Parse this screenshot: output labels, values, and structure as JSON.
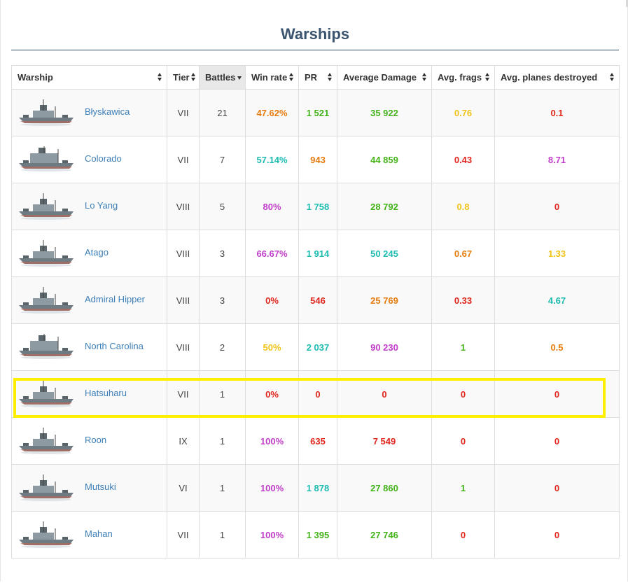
{
  "title": "Warships",
  "columns": [
    "Warship",
    "Tier",
    "Battles",
    "Win rate",
    "PR",
    "Average Damage",
    "Avg. frags",
    "Avg. planes destroyed"
  ],
  "sorted_column": "Battles",
  "colors": {
    "title": "#3b5470",
    "link": "#3d7fb8",
    "red": "#e0261d",
    "orange": "#e77c0e",
    "yellow": "#f0c419",
    "green": "#44b31a",
    "teal": "#1dbcb0",
    "purple": "#c13ec9",
    "highlight_box": "#ffee00"
  },
  "rows": [
    {
      "ship": "Błyskawica",
      "tier": "VII",
      "battles": "21",
      "winrate": "47.62%",
      "winrate_color": "#e77c0e",
      "pr": "1 521",
      "pr_color": "#44b31a",
      "dmg": "35 922",
      "dmg_color": "#44b31a",
      "frags": "0.76",
      "frags_color": "#f0c419",
      "planes": "0.1",
      "planes_color": "#e0261d",
      "icon": "destroyer-icon"
    },
    {
      "ship": "Colorado",
      "tier": "VII",
      "battles": "7",
      "winrate": "57.14%",
      "winrate_color": "#1dbcb0",
      "pr": "943",
      "pr_color": "#e77c0e",
      "dmg": "44 859",
      "dmg_color": "#44b31a",
      "frags": "0.43",
      "frags_color": "#e0261d",
      "planes": "8.71",
      "planes_color": "#c13ec9",
      "icon": "battleship-icon"
    },
    {
      "ship": "Lo Yang",
      "tier": "VIII",
      "battles": "5",
      "winrate": "80%",
      "winrate_color": "#c13ec9",
      "pr": "1 758",
      "pr_color": "#1dbcb0",
      "dmg": "28 792",
      "dmg_color": "#44b31a",
      "frags": "0.8",
      "frags_color": "#f0c419",
      "planes": "0",
      "planes_color": "#e0261d",
      "icon": "destroyer-icon"
    },
    {
      "ship": "Atago",
      "tier": "VIII",
      "battles": "3",
      "winrate": "66.67%",
      "winrate_color": "#c13ec9",
      "pr": "1 914",
      "pr_color": "#1dbcb0",
      "dmg": "50 245",
      "dmg_color": "#1dbcb0",
      "frags": "0.67",
      "frags_color": "#e77c0e",
      "planes": "1.33",
      "planes_color": "#f0c419",
      "icon": "cruiser-icon"
    },
    {
      "ship": "Admiral Hipper",
      "tier": "VIII",
      "battles": "3",
      "winrate": "0%",
      "winrate_color": "#e0261d",
      "pr": "546",
      "pr_color": "#e0261d",
      "dmg": "25 769",
      "dmg_color": "#e77c0e",
      "frags": "0.33",
      "frags_color": "#e0261d",
      "planes": "4.67",
      "planes_color": "#1dbcb0",
      "icon": "cruiser-icon"
    },
    {
      "ship": "North Carolina",
      "tier": "VIII",
      "battles": "2",
      "winrate": "50%",
      "winrate_color": "#f0c419",
      "pr": "2 037",
      "pr_color": "#1dbcb0",
      "dmg": "90 230",
      "dmg_color": "#c13ec9",
      "frags": "1",
      "frags_color": "#44b31a",
      "planes": "0.5",
      "planes_color": "#e77c0e",
      "icon": "battleship-icon"
    },
    {
      "ship": "Hatsuharu",
      "tier": "VII",
      "battles": "1",
      "winrate": "0%",
      "winrate_color": "#e0261d",
      "pr": "0",
      "pr_color": "#e0261d",
      "dmg": "0",
      "dmg_color": "#e0261d",
      "frags": "0",
      "frags_color": "#e0261d",
      "planes": "0",
      "planes_color": "#e0261d",
      "icon": "destroyer-icon"
    },
    {
      "ship": "Roon",
      "tier": "IX",
      "battles": "1",
      "winrate": "100%",
      "winrate_color": "#c13ec9",
      "pr": "635",
      "pr_color": "#e0261d",
      "dmg": "7 549",
      "dmg_color": "#e0261d",
      "frags": "0",
      "frags_color": "#e0261d",
      "planes": "0",
      "planes_color": "#e0261d",
      "icon": "cruiser-icon"
    },
    {
      "ship": "Mutsuki",
      "tier": "VI",
      "battles": "1",
      "winrate": "100%",
      "winrate_color": "#c13ec9",
      "pr": "1 878",
      "pr_color": "#1dbcb0",
      "dmg": "27 860",
      "dmg_color": "#44b31a",
      "frags": "1",
      "frags_color": "#44b31a",
      "planes": "0",
      "planes_color": "#e0261d",
      "icon": "destroyer-icon"
    },
    {
      "ship": "Mahan",
      "tier": "VII",
      "battles": "1",
      "winrate": "100%",
      "winrate_color": "#c13ec9",
      "pr": "1 395",
      "pr_color": "#44b31a",
      "dmg": "27 746",
      "dmg_color": "#44b31a",
      "frags": "0",
      "frags_color": "#e0261d",
      "planes": "0",
      "planes_color": "#e0261d",
      "icon": "destroyer-icon"
    }
  ]
}
